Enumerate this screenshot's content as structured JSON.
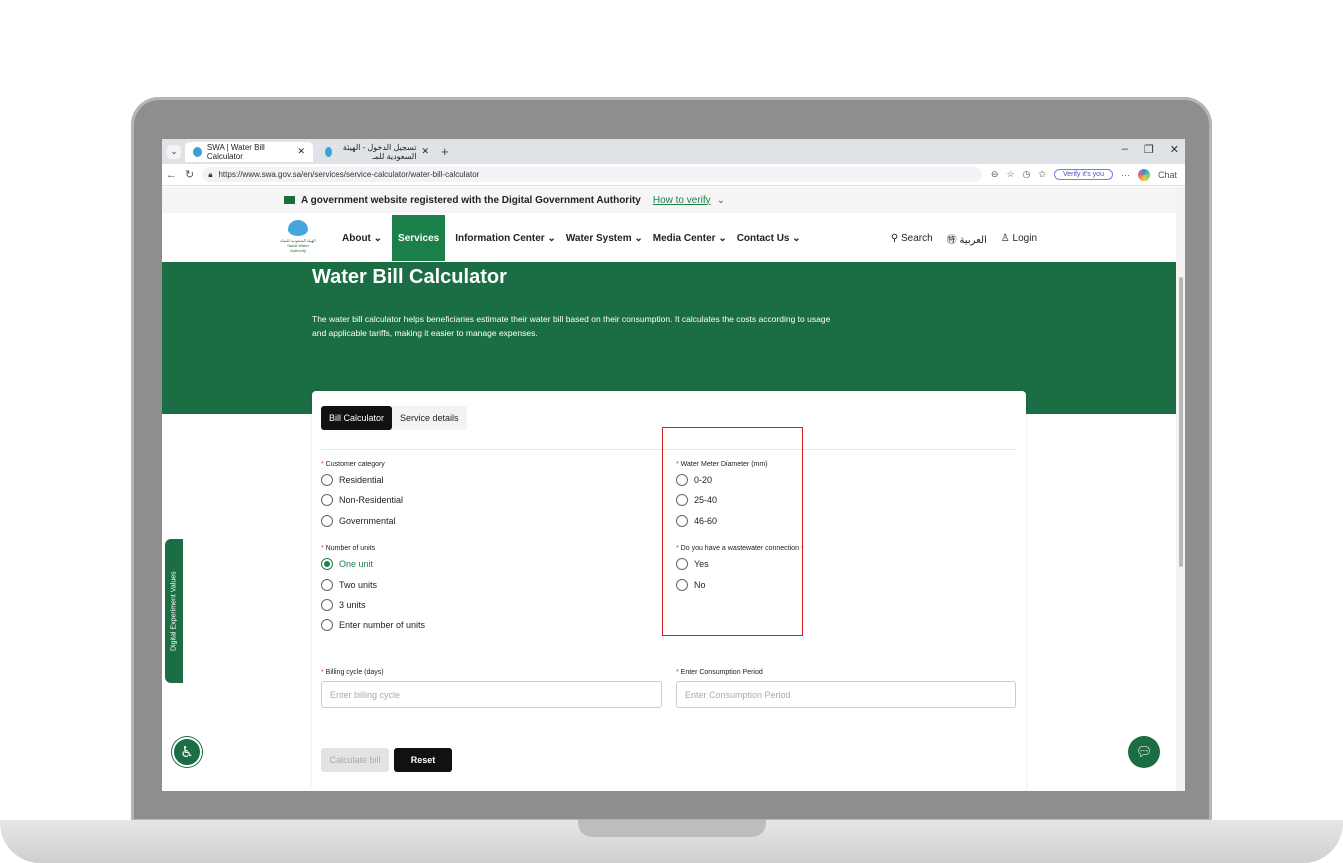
{
  "browser": {
    "tabs": [
      {
        "label": "SWA | Water Bill Calculator",
        "active": true
      },
      {
        "label": "تسجيل الدخول - الهيئة السعودية للمـ",
        "active": false
      }
    ],
    "url": "https://www.swa.gov.sa/en/services/service-calculator/water-bill-calculator",
    "verify_label": "Verify it's you",
    "chat_label": "Chat"
  },
  "gov_banner": {
    "text": "A government website registered with the Digital Government Authority",
    "link": "How to verify"
  },
  "header": {
    "logo_text": "الهيئة السعودية للمياه Saudi Water Authority",
    "menu": [
      "About ⌄",
      "Services",
      "Information Center ⌄",
      "Water System ⌄",
      "Media Center ⌄",
      "Contact Us ⌄"
    ],
    "search": "Search",
    "language": "العربية",
    "login": "Login"
  },
  "hero": {
    "title": "Water Bill Calculator",
    "description": "The water bill calculator helps beneficiaries estimate their water bill based on their consumption. It calculates the costs according to usage and applicable tariffs, making it easier to manage expenses."
  },
  "form": {
    "tabs": [
      "Bill Calculator",
      "Service details"
    ],
    "customer_category": {
      "label": "Customer category",
      "options": [
        "Residential",
        "Non-Residential",
        "Governmental"
      ]
    },
    "meter_diameter": {
      "label": "Water Meter Diameter (mm)",
      "options": [
        "0-20",
        "25-40",
        "46-60"
      ]
    },
    "units": {
      "label": "Number of units",
      "options": [
        "One unit",
        "Two units",
        "3 units",
        "Enter number of units"
      ],
      "selected": "One unit"
    },
    "wastewater": {
      "label": "Do you have a wastewater connection",
      "options": [
        "Yes",
        "No"
      ]
    },
    "billing_cycle": {
      "label": "Billing cycle (days)",
      "placeholder": "Enter billing cycle"
    },
    "consumption": {
      "label": "Enter Consumption Period",
      "placeholder": "Enter Consumption Period"
    },
    "calculate": "Calculate bill",
    "reset": "Reset"
  },
  "side_tab": "Digital Experiment Values",
  "colors": {
    "brand_green": "#1b6e43",
    "highlight_red": "#d62020"
  }
}
